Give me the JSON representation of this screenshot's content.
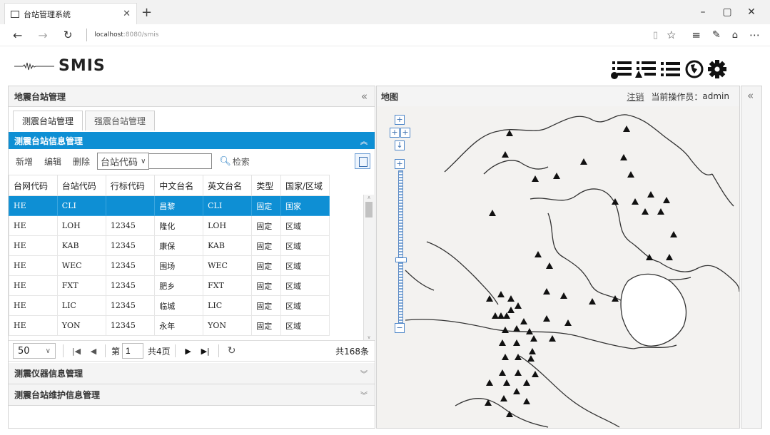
{
  "browser": {
    "tab_title": "台站管理系统",
    "url_host": "localhost",
    "url_rest": ":8080/smis",
    "window_controls": [
      "–",
      "▢",
      "✕"
    ]
  },
  "app": {
    "title": "SMIS"
  },
  "left_panel": {
    "title": "地震台站管理",
    "tabs": [
      {
        "label": "测震台站管理",
        "active": true
      },
      {
        "label": "强震台站管理",
        "active": false
      }
    ],
    "section_title": "测震台站信息管理",
    "toolbar": {
      "add": "新增",
      "edit": "编辑",
      "delete": "删除",
      "search_field": "台站代码",
      "search_value": "",
      "search_button": "检索"
    },
    "table": {
      "columns": [
        "台网代码",
        "台站代码",
        "行标代码",
        "中文台名",
        "英文台名",
        "类型",
        "国家/区域"
      ],
      "rows": [
        [
          "HE",
          "CLI",
          "",
          "昌黎",
          "CLI",
          "固定",
          "国家"
        ],
        [
          "HE",
          "LOH",
          "12345",
          "隆化",
          "LOH",
          "固定",
          "区域"
        ],
        [
          "HE",
          "KAB",
          "12345",
          "康保",
          "KAB",
          "固定",
          "区域"
        ],
        [
          "HE",
          "WEC",
          "12345",
          "围场",
          "WEC",
          "固定",
          "区域"
        ],
        [
          "HE",
          "FXT",
          "12345",
          "肥乡",
          "FXT",
          "固定",
          "区域"
        ],
        [
          "HE",
          "LIC",
          "12345",
          "临城",
          "LIC",
          "固定",
          "区域"
        ],
        [
          "HE",
          "YON",
          "12345",
          "永年",
          "YON",
          "固定",
          "区域"
        ]
      ],
      "selected_row": 0
    },
    "pager": {
      "page_size": "50",
      "page_prefix": "第",
      "page_number": "1",
      "total_pages": "共4页",
      "total_records": "共168条"
    },
    "collapsed_sections": [
      "测震仪器信息管理",
      "测震台站维护信息管理"
    ]
  },
  "map_panel": {
    "title": "地图",
    "logout": "注销",
    "operator_label": "当前操作员：",
    "operator_name": "admin",
    "station_count": 57
  }
}
